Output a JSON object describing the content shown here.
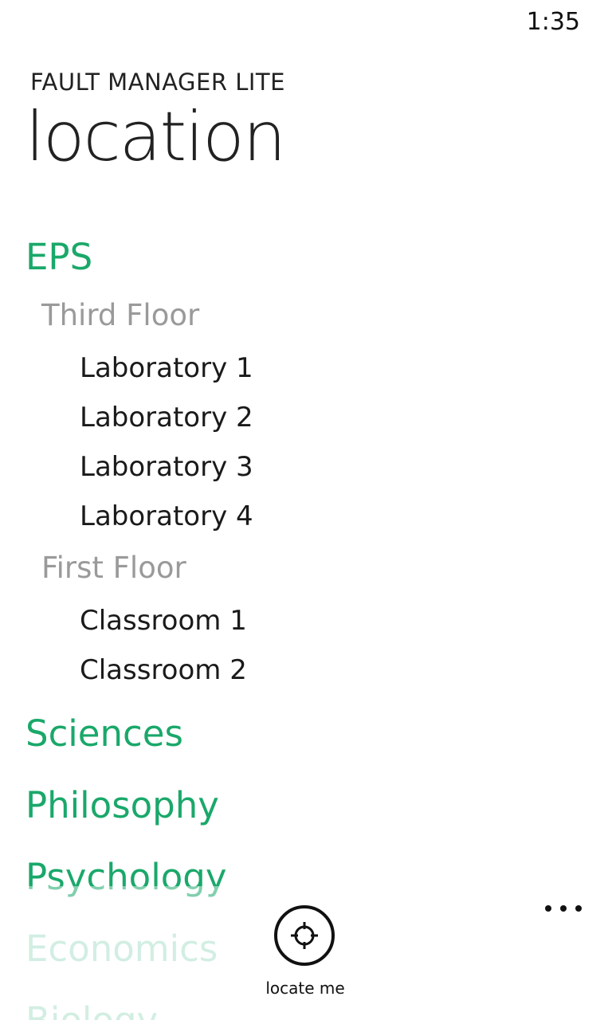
{
  "status_bar": {
    "time": "1:35"
  },
  "header": {
    "app_title": "FAULT MANAGER LITE",
    "page_title": "location"
  },
  "theme": {
    "accent": "#1aa86a",
    "floor_color": "#9a9a9a",
    "room_color": "#1a1a1a"
  },
  "tree": {
    "buildings": [
      {
        "name": "EPS",
        "floors": [
          {
            "name": "Third Floor",
            "rooms": [
              "Laboratory 1",
              "Laboratory 2",
              "Laboratory 3",
              "Laboratory 4"
            ]
          },
          {
            "name": "First Floor",
            "rooms": [
              "Classroom 1",
              "Classroom 2"
            ]
          }
        ]
      },
      {
        "name": "Sciences"
      },
      {
        "name": "Philosophy"
      },
      {
        "name": "Psychology"
      },
      {
        "name": "Economics"
      },
      {
        "name": "Biology"
      }
    ]
  },
  "app_bar": {
    "locate_label": "locate me",
    "locate_icon": "crosshair-icon",
    "more_icon": "more-icon"
  }
}
